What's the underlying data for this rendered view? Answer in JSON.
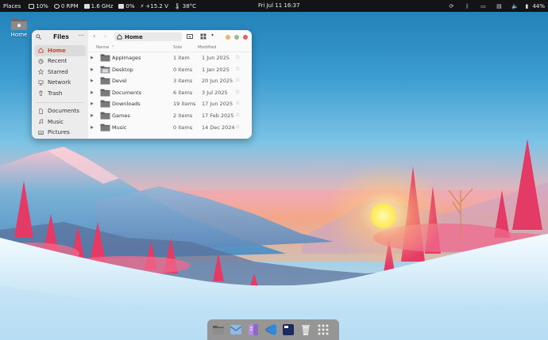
{
  "topbar": {
    "places_label": "Places",
    "cpu": "10%",
    "fan": "0 RPM",
    "freq": "1.6 GHz",
    "load": "0%",
    "voltage": "+15.2 V",
    "temp": "38°C",
    "clock": "Fri Jul 11  16:37",
    "battery": "44%"
  },
  "desktop": {
    "home_label": "Home"
  },
  "files": {
    "title": "Files",
    "path_label": "Home",
    "columns": {
      "name": "Name",
      "size": "Size",
      "modified": "Modified"
    },
    "sidebar": [
      {
        "label": "Home",
        "icon": "home-icon",
        "active": true
      },
      {
        "label": "Recent",
        "icon": "clock-icon"
      },
      {
        "label": "Starred",
        "icon": "star-icon"
      },
      {
        "label": "Network",
        "icon": "network-icon"
      },
      {
        "label": "Trash",
        "icon": "trash-icon"
      },
      {
        "label": "Documents",
        "icon": "document-icon"
      },
      {
        "label": "Music",
        "icon": "music-icon"
      },
      {
        "label": "Pictures",
        "icon": "picture-icon"
      }
    ],
    "rows": [
      {
        "name": "AppImages",
        "size": "1 item",
        "modified": "1 Jun 2025"
      },
      {
        "name": "Desktop",
        "size": "0 items",
        "modified": "1 Jan 2025"
      },
      {
        "name": "Devel",
        "size": "3 items",
        "modified": "20 Jun 2025"
      },
      {
        "name": "Documents",
        "size": "6 items",
        "modified": "3 Jul 2025"
      },
      {
        "name": "Downloads",
        "size": "19 items",
        "modified": "17 Jun 2025"
      },
      {
        "name": "Games",
        "size": "2 items",
        "modified": "17 Feb 2025"
      },
      {
        "name": "Music",
        "size": "0 items",
        "modified": "14 Dec 2024"
      }
    ]
  },
  "dock": [
    {
      "name": "files-app-icon"
    },
    {
      "name": "mail-app-icon"
    },
    {
      "name": "notes-app-icon"
    },
    {
      "name": "vscode-app-icon"
    },
    {
      "name": "terminal-app-icon"
    },
    {
      "name": "trash-app-icon"
    },
    {
      "name": "app-grid-icon"
    }
  ],
  "colors": {
    "accent": "#c9462c",
    "panel": "#141417",
    "window_bg": "#fafafa",
    "sidebar_bg": "#ececec"
  }
}
